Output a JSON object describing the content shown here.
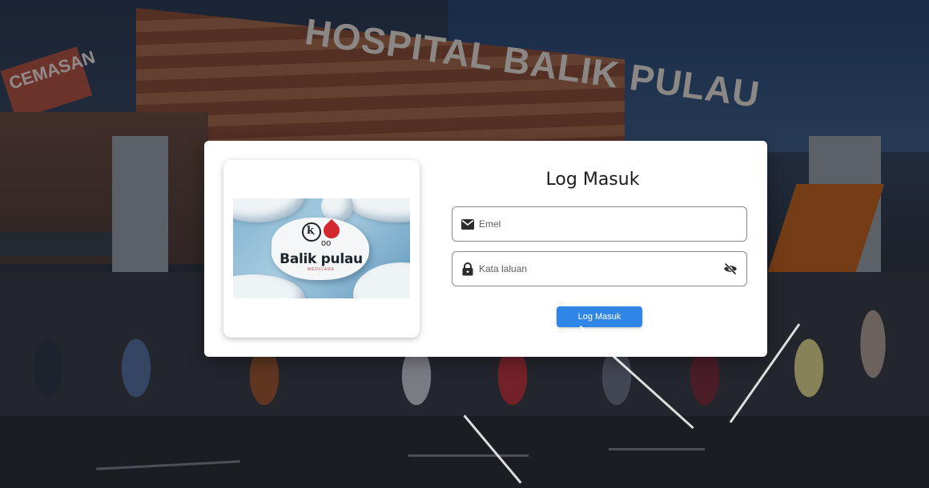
{
  "background": {
    "building_sign": "HOSPITAL BALIK PULAU",
    "side_sign": "CEMASAN"
  },
  "brand": {
    "name": "Balik pulau",
    "tagline": "MEDICARE"
  },
  "login": {
    "title": "Log Masuk",
    "email_placeholder": "Emel",
    "password_placeholder": "Kata laluan",
    "submit_label": "Log Masuk"
  },
  "colors": {
    "button": "#2f86e6",
    "card": "#ffffff",
    "logo_drop": "#d3262e"
  },
  "icons": {
    "email": "envelope-icon",
    "password": "lock-icon",
    "toggle": "eye-slash-icon"
  }
}
